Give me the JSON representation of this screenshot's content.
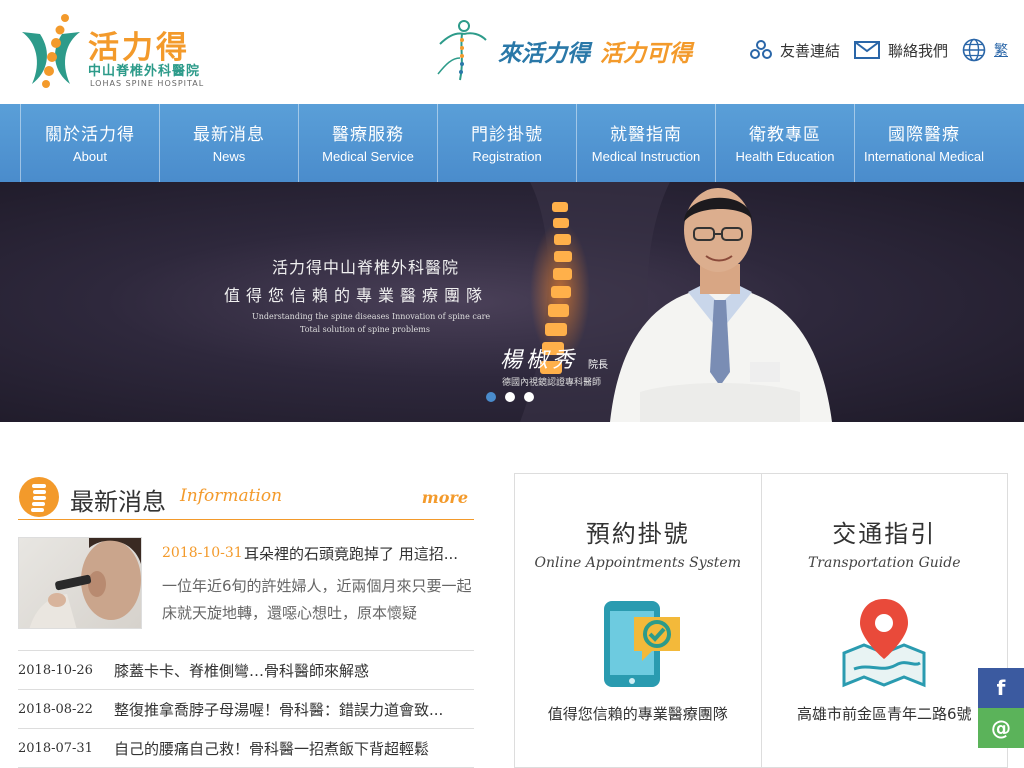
{
  "header": {
    "logo_cn": "活力得",
    "logo_sub": "中山脊椎外科醫院",
    "logo_en": "LOHAS SPINE HOSPITAL",
    "slogan_a": "來活力得",
    "slogan_b": "活力可得",
    "links": {
      "friends": "友善連結",
      "contact": "聯絡我們",
      "lang": "繁"
    }
  },
  "nav": [
    {
      "cn": "關於活力得",
      "en": "About"
    },
    {
      "cn": "最新消息",
      "en": "News"
    },
    {
      "cn": "醫療服務",
      "en": "Medical Service"
    },
    {
      "cn": "門診掛號",
      "en": "Registration"
    },
    {
      "cn": "就醫指南",
      "en": "Medical Instruction"
    },
    {
      "cn": "衛教專區",
      "en": "Health Education"
    },
    {
      "cn": "國際醫療",
      "en": "International Medical"
    }
  ],
  "banner": {
    "title": "活力得中山脊椎外科醫院",
    "tagline": "值得您信賴的專業醫療團隊",
    "en_line1": "Understanding the spine diseases Innovation of spine care",
    "en_line2": "Total solution of spine problems",
    "signature": "楊椒秀",
    "sign_title": "院長",
    "credential": "德國內視鏡認證專科醫師",
    "active_slide": 1,
    "slide_count": 3
  },
  "news": {
    "title": "最新消息",
    "title_en": "Information",
    "more": "more",
    "feature": {
      "date": "2018-10-31",
      "headline": "耳朵裡的石頭竟跑掉了 用這招...",
      "desc": "一位年近6旬的許姓婦人，近兩個月來只要一起床就天旋地轉，還噁心想吐，原本懷疑"
    },
    "items": [
      {
        "date": "2018-10-26",
        "title": "膝蓋卡卡、脊椎側彎…骨科醫師來解惑"
      },
      {
        "date": "2018-08-22",
        "title": "整復推拿喬脖子母湯喔！骨科醫：錯誤力道會致..."
      },
      {
        "date": "2018-07-31",
        "title": "自己的腰痛自己救！骨科醫一招煮飯下背超輕鬆"
      }
    ]
  },
  "services": [
    {
      "title": "預約掛號",
      "en": "Online Appointments System",
      "desc": "值得您信賴的專業醫療團隊",
      "icon": "phone-check-icon"
    },
    {
      "title": "交通指引",
      "en": "Transportation Guide",
      "desc": "高雄市前金區青年二路6號",
      "icon": "map-pin-icon"
    }
  ],
  "social": {
    "facebook": "f",
    "email": "@"
  },
  "colors": {
    "brand_orange": "#f39a2b",
    "brand_teal": "#2d9b8a",
    "nav_blue": "#4a8ccc"
  }
}
